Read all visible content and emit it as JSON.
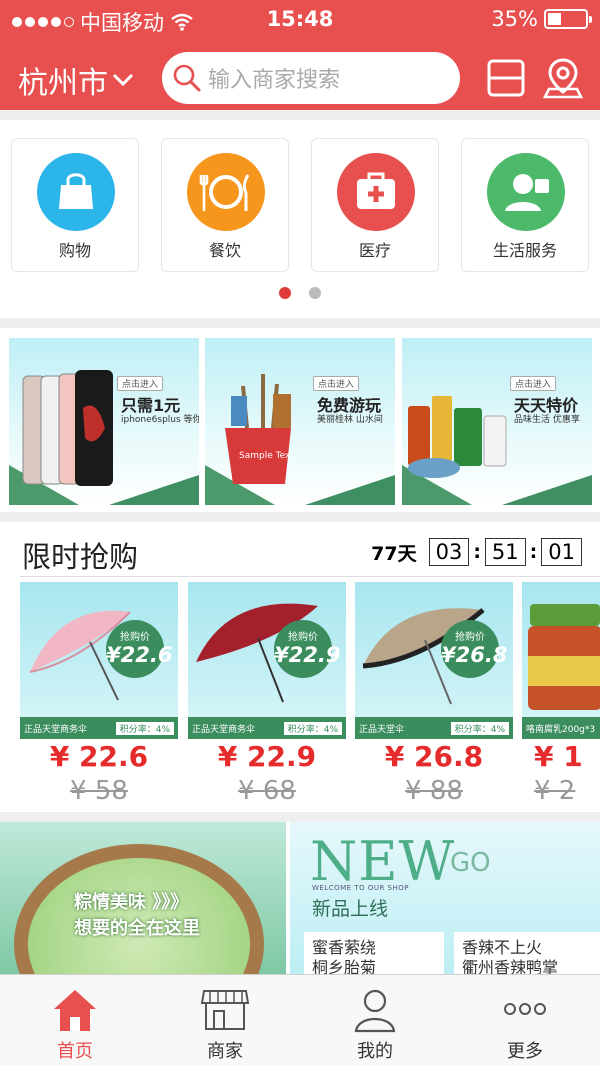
{
  "status_bar": {
    "carrier": "中国移动",
    "time": "15:48",
    "battery_percent": "35%",
    "battery_level": 0.35,
    "signal_bars_filled": 4,
    "signal_bars_total": 5
  },
  "header": {
    "city": "杭州市",
    "search_placeholder": "输入商家搜索"
  },
  "categories": [
    {
      "label": "购物",
      "icon": "shopping-bag-icon",
      "color": "#2bb5e8"
    },
    {
      "label": "餐饮",
      "icon": "dining-icon",
      "color": "#f6961d"
    },
    {
      "label": "医疗",
      "icon": "medical-kit-icon",
      "color": "#e84f4f"
    },
    {
      "label": "生活服务",
      "icon": "customer-service-icon",
      "color": "#4cba6a"
    }
  ],
  "category_pager": {
    "pages": 2,
    "current": 1
  },
  "promos": [
    {
      "tag": "点击进入",
      "title": "只需1元",
      "sub": "iphone6splus 等你拿"
    },
    {
      "tag": "点击进入",
      "title": "免费游玩",
      "sub": "美丽桂林 山水间"
    },
    {
      "tag": "点击进入",
      "title": "天天特价",
      "sub": "品味生活 优惠享"
    }
  ],
  "flash_sale": {
    "title": "限时抢购",
    "countdown": {
      "days": "77天",
      "hours": "03",
      "minutes": "51",
      "seconds": "01"
    },
    "products": [
      {
        "badge_label": "抢购价",
        "badge_price": "¥22.6",
        "name": "正品天堂商务伞",
        "rate": "积分率：4%",
        "price": "¥ 22.6",
        "old_price": "¥ 58"
      },
      {
        "badge_label": "抢购价",
        "badge_price": "¥22.9",
        "name": "正品天堂商务伞",
        "rate": "积分率：4%",
        "price": "¥ 22.9",
        "old_price": "¥ 68"
      },
      {
        "badge_label": "抢购价",
        "badge_price": "¥26.8",
        "name": "正品天堂伞",
        "rate": "积分率：4%",
        "price": "¥ 26.8",
        "old_price": "¥ 88"
      },
      {
        "badge_label": "",
        "badge_price": "",
        "name": "咯南腐乳200g*3",
        "rate": "",
        "price": "¥ 1",
        "old_price": "¥ 2"
      }
    ]
  },
  "banners": {
    "left": {
      "line1": "粽情美味 》》》",
      "line2": "想要的全在这里"
    },
    "right": {
      "new": "NEW",
      "go": "GO",
      "welcome": "WELCOME TO OUR SHOP",
      "new_products": "新品上线",
      "card1": {
        "line1": "蜜香萦绕",
        "line2": "桐乡胎菊"
      },
      "card2": {
        "line1": "香辣不上火",
        "line2": "衢州香辣鸭掌"
      }
    }
  },
  "tabbar": [
    {
      "label": "首页",
      "icon": "home-icon",
      "active": true
    },
    {
      "label": "商家",
      "icon": "storefront-icon",
      "active": false
    },
    {
      "label": "我的",
      "icon": "user-icon",
      "active": false
    },
    {
      "label": "更多",
      "icon": "more-icon",
      "active": false
    }
  ],
  "colors": {
    "brand": "#e84f4f",
    "price": "#e52b2b",
    "accent_green": "#3c8d5e"
  }
}
